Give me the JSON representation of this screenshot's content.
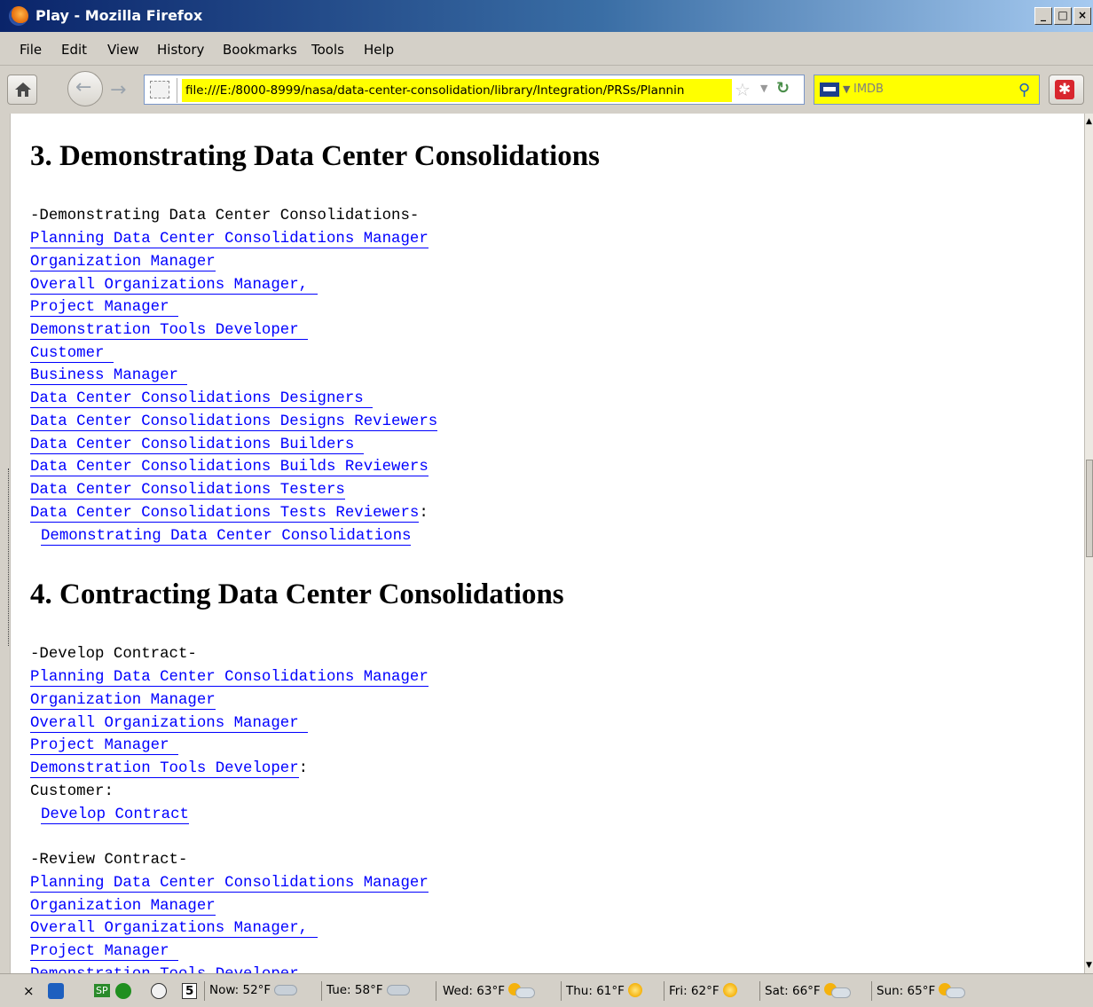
{
  "window": {
    "title": "Play - Mozilla Firefox",
    "controls": [
      "_",
      "□",
      "×"
    ]
  },
  "menu": [
    "File",
    "Edit",
    "View",
    "History",
    "Bookmarks",
    "Tools",
    "Help"
  ],
  "nav": {
    "url": "file:///E:/8000-8999/nasa/data-center-consolidation/library/Integration/PRSs/Plannin",
    "search_placeholder": "IMDB"
  },
  "sections": [
    {
      "heading": "3. Demonstrating Data Center Consolidations",
      "label": "-Demonstrating Data Center Consolidations-",
      "links": [
        "Planning Data Center Consolidations Manager",
        "Organization Manager",
        "Overall Organizations Manager, ",
        "Project Manager ",
        "Demonstration Tools Developer ",
        "Customer ",
        "Business Manager ",
        "Data Center Consolidations Designers ",
        "Data Center Consolidations Designs Reviewers",
        "Data Center Consolidations Builders ",
        "Data Center Consolidations Builds Reviewers",
        "Data Center Consolidations Testers",
        "Data Center Consolidations Tests Reviewers"
      ],
      "suffix": ":",
      "action": "Demonstrating Data Center Consolidations"
    },
    {
      "heading": "4. Contracting Data Center Consolidations",
      "groups": [
        {
          "label": "-Develop Contract-",
          "links": [
            "Planning Data Center Consolidations Manager",
            "Organization Manager",
            "Overall Organizations Manager ",
            "Project Manager ",
            "Demonstration Tools Developer"
          ],
          "suffix": ":",
          "extra": "Customer:",
          "action": "Develop Contract"
        },
        {
          "label": "-Review Contract-",
          "links": [
            "Planning Data Center Consolidations Manager",
            "Organization Manager",
            "Overall Organizations Manager, ",
            "Project Manager ",
            "Demonstration Tools Developer"
          ]
        }
      ]
    }
  ],
  "status": {
    "close": "×",
    "sp": "SP",
    "calendar_day": "5",
    "weather": [
      {
        "text": "Now: 52°F",
        "icon": "cloud-icon"
      },
      {
        "text": "Tue: 58°F",
        "icon": "cloud-icon"
      },
      {
        "text": "Wed: 63°F",
        "icon": "sun-cloud-icon"
      },
      {
        "text": "Thu: 61°F",
        "icon": "sun-icon"
      },
      {
        "text": "Fri: 62°F",
        "icon": "sun-icon"
      },
      {
        "text": "Sat: 66°F",
        "icon": "sun-cloud-icon"
      },
      {
        "text": "Sun: 65°F",
        "icon": "sun-cloud-icon"
      }
    ]
  }
}
